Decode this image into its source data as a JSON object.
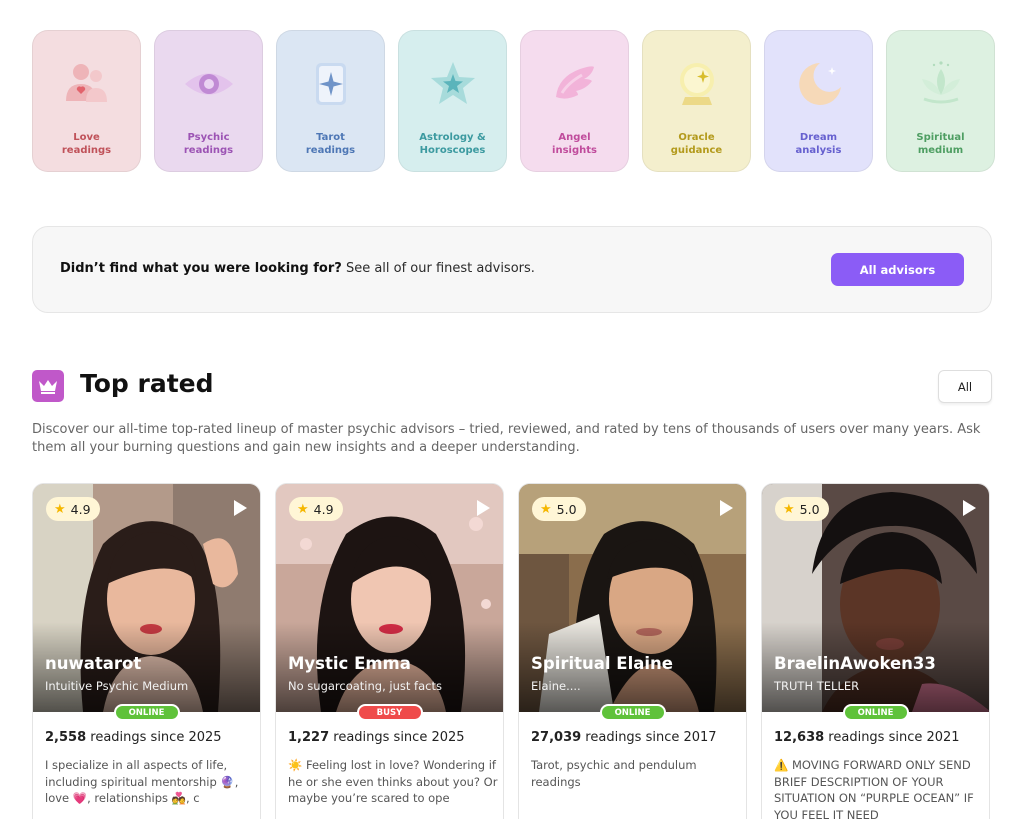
{
  "categories": [
    {
      "label": "Love\nreadings",
      "bg": "#f4dde0",
      "color": "#c0525a",
      "icon": "couple-heart-icon"
    },
    {
      "label": "Psychic\nreadings",
      "bg": "#ead9ef",
      "color": "#9c54b4",
      "icon": "eye-icon"
    },
    {
      "label": "Tarot\nreadings",
      "bg": "#dbe6f3",
      "color": "#4e77b5",
      "icon": "tarot-card-icon"
    },
    {
      "label": "Astrology &\nHoroscopes",
      "bg": "#d6eeee",
      "color": "#3c9aa0",
      "icon": "star-icon"
    },
    {
      "label": "Angel\ninsights",
      "bg": "#f5dcee",
      "color": "#c04c9c",
      "icon": "angel-wing-icon"
    },
    {
      "label": "Oracle\nguidance",
      "bg": "#f4efcd",
      "color": "#b39a1c",
      "icon": "crystal-ball-icon"
    },
    {
      "label": "Dream\nanalysis",
      "bg": "#e2e2fb",
      "color": "#6660cf",
      "icon": "moon-icon"
    },
    {
      "label": "Spiritual\nmedium",
      "bg": "#ddf1e1",
      "color": "#4e9e62",
      "icon": "lotus-icon"
    }
  ],
  "cta": {
    "bold": "Didn’t find what you were looking for?",
    "text": " See all of our finest advisors.",
    "button": "All advisors"
  },
  "section": {
    "title": "Top rated",
    "filter": "All",
    "description": "Discover our all-time top-rated lineup of master psychic advisors – tried, reviewed, and rated by tens of thousands of users over many years. Ask them all your burning questions and gain new insights and a deeper understanding."
  },
  "advisors": [
    {
      "name": "nuwatarot",
      "tagline": "Intuitive Psychic Medium",
      "rating": "4.9",
      "status": "ONLINE",
      "count": "2,558",
      "since": " readings since 2025",
      "bio": "I specialize in all aspects of life, including spiritual mentorship 🔮, love 💗, relationships 💑, c"
    },
    {
      "name": "Mystic Emma",
      "tagline": "No sugarcoating, just facts",
      "rating": "4.9",
      "status": "BUSY",
      "count": "1,227",
      "since": " readings since 2025",
      "bio": "☀️ Feeling lost in love? Wondering if he or she even thinks about you? Or maybe you’re scared to ope"
    },
    {
      "name": "Spiritual Elaine",
      "tagline": "Elaine....",
      "rating": "5.0",
      "status": "ONLINE",
      "count": "27,039",
      "since": " readings since 2017",
      "bio": "Tarot, psychic and pendulum readings"
    },
    {
      "name": "BraelinAwoken33",
      "tagline": "TRUTH TELLER",
      "rating": "5.0",
      "status": "ONLINE",
      "count": "12,638",
      "since": " readings since 2021",
      "bio": "⚠️ MOVING FORWARD ONLY SEND BRIEF DESCRIPTION OF YOUR SITUATION ON “PURPLE OCEAN” IF YOU FEEL IT NEED"
    }
  ],
  "colors": {
    "accent": "#8b5cf6",
    "online": "#5fc23a",
    "busy": "#ef4b4b",
    "crown_bg": "#c058c9",
    "rating_bg": "#fff6d6"
  }
}
